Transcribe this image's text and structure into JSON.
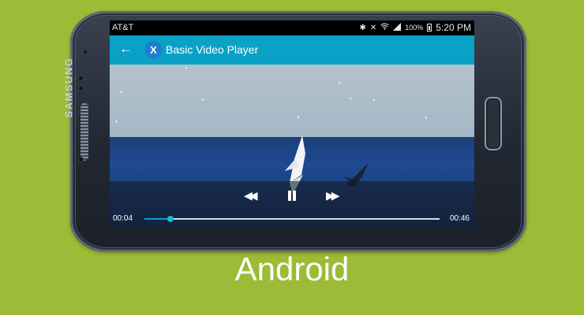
{
  "status_bar": {
    "carrier": "AT&T",
    "battery": "100%",
    "time": "5:20 PM",
    "icons": [
      "bluetooth-icon",
      "mute-icon",
      "wifi-icon",
      "signal-icon",
      "battery-icon"
    ]
  },
  "action_bar": {
    "title": "Basic Video Player",
    "back_icon": "back-arrow-icon",
    "logo_glyph": "X",
    "color": "#0aa1c6"
  },
  "player": {
    "elapsed": "00:04",
    "duration": "00:46",
    "progress": 0.087,
    "accent": "#0aa1c6",
    "buttons": [
      "rewind-icon",
      "pause-icon",
      "fast-forward-icon"
    ]
  },
  "device": {
    "brand": "SAMSUNG"
  },
  "caption": "Android"
}
